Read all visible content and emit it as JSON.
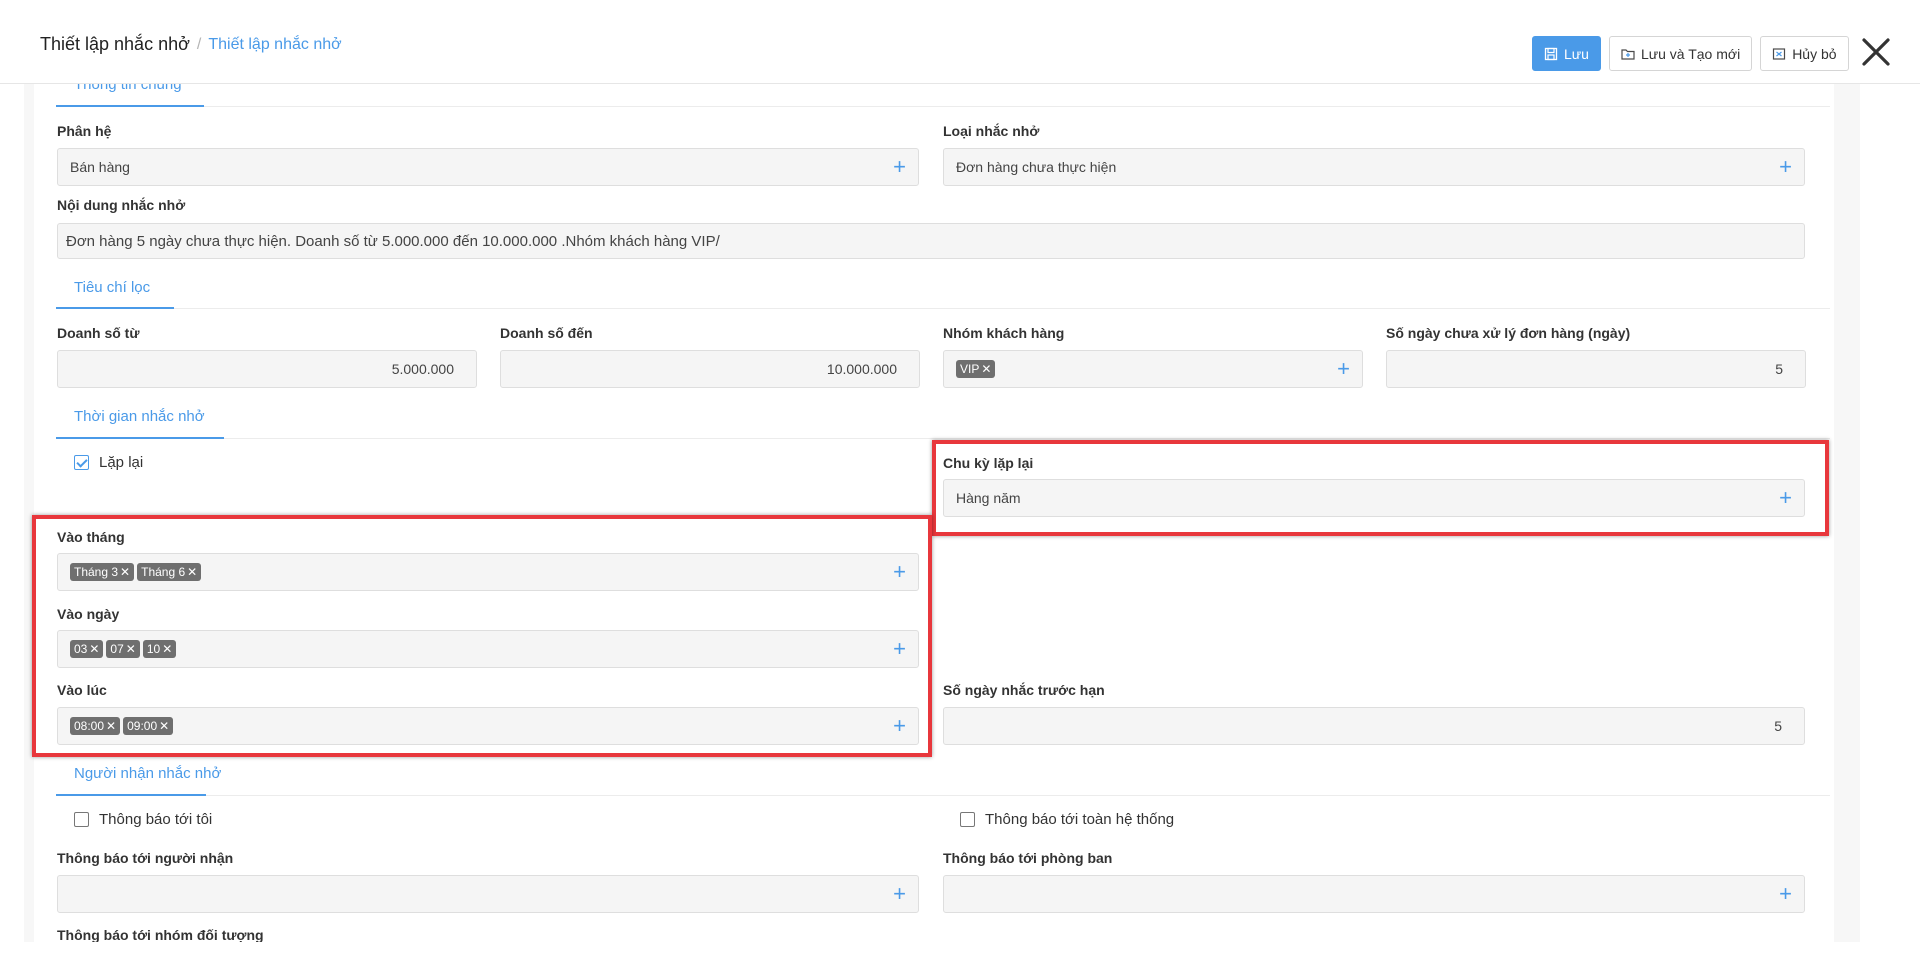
{
  "breadcrumb": {
    "current": "Thiết lập nhắc nhở",
    "separator": "/",
    "link": "Thiết lập nhắc nhở"
  },
  "toolbar": {
    "save": "Lưu",
    "save_new": "Lưu và Tạo mới",
    "cancel": "Hủy bỏ",
    "close_icon": "close-icon"
  },
  "sections": {
    "general": "Thông tin chung",
    "filter": "Tiêu chí lọc",
    "time": "Thời gian nhắc nhở",
    "recipients": "Người nhận nhắc nhở"
  },
  "general": {
    "module_label": "Phân hệ",
    "module_value": "Bán hàng",
    "type_label": "Loại nhắc nhở",
    "type_value": "Đơn hàng chưa thực hiện",
    "content_label": "Nội dung nhắc nhở",
    "content_value": "Đơn hàng 5 ngày chưa thực hiện. Doanh số từ 5.000.000 đến 10.000.000 .Nhóm khách hàng VIP/"
  },
  "filter": {
    "from_label": "Doanh số từ",
    "from_value": "5.000.000",
    "to_label": "Doanh số đến",
    "to_value": "10.000.000",
    "group_label": "Nhóm khách hàng",
    "group_tags": [
      "VIP"
    ],
    "days_label": "Số ngày chưa xử lý đơn hàng (ngày)",
    "days_value": "5"
  },
  "time": {
    "repeat_label": "Lặp lại",
    "repeat_checked": true,
    "cycle_label": "Chu kỳ lặp lại",
    "cycle_value": "Hàng năm",
    "month_label": "Vào tháng",
    "month_tags": [
      "Tháng 3",
      "Tháng 6"
    ],
    "day_label": "Vào ngày",
    "day_tags": [
      "03",
      "07",
      "10"
    ],
    "at_label": "Vào lúc",
    "at_tags": [
      "08:00",
      "09:00"
    ],
    "before_label": "Số ngày nhắc trước hạn",
    "before_value": "5"
  },
  "recipients": {
    "notify_me": "Thông báo tới tôi",
    "notify_all": "Thông báo tới toàn hệ thống",
    "to_person_label": "Thông báo tới người nhận",
    "to_dept_label": "Thông báo tới phòng ban",
    "to_group_label": "Thông báo tới nhóm đối tượng"
  },
  "colors": {
    "accent": "#4a9ae8",
    "highlight": "#e8373c",
    "tag": "#6f6f6f"
  }
}
